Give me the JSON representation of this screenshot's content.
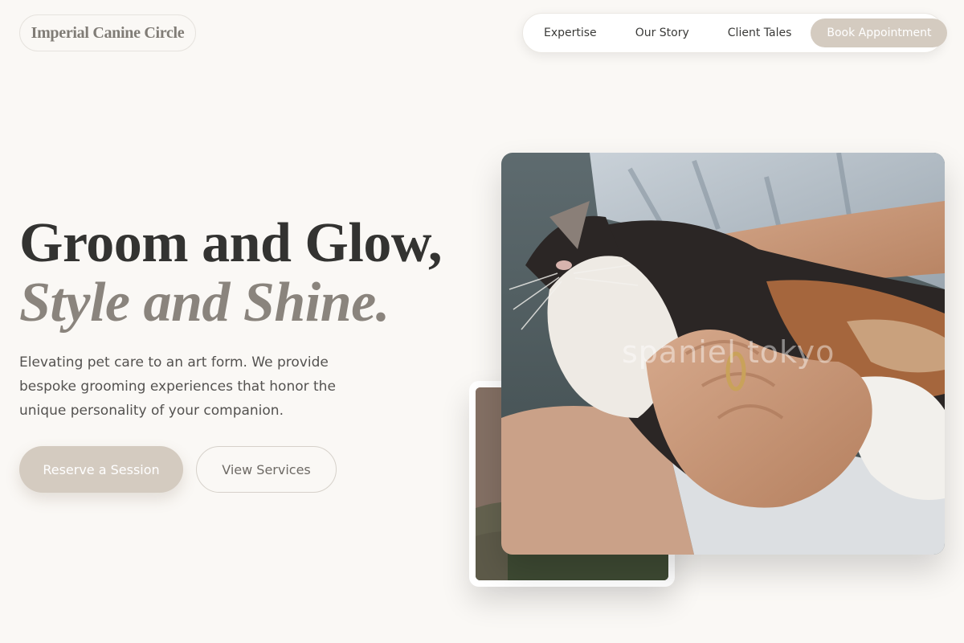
{
  "brand": {
    "logo_text": "Imperial Canine Circle"
  },
  "nav": {
    "items": [
      {
        "label": "Expertise"
      },
      {
        "label": "Our Story"
      },
      {
        "label": "Client Tales"
      }
    ],
    "cta_label": "Book Appointment"
  },
  "hero": {
    "headline_line1": "Groom and Glow,",
    "headline_line2": "Style and Shine.",
    "description": "Elevating pet care to an art form. We provide bespoke grooming experiences that honor the unique personality of your companion.",
    "primary_button": "Reserve a Session",
    "secondary_button": "View Services"
  },
  "images": {
    "main_photo_watermark": "spaniel tokyo"
  },
  "colors": {
    "background": "#faf8f5",
    "accent": "#d4cbc0",
    "headline": "#333331",
    "headline_italic": "#8a847d",
    "logo": "#807c76"
  }
}
